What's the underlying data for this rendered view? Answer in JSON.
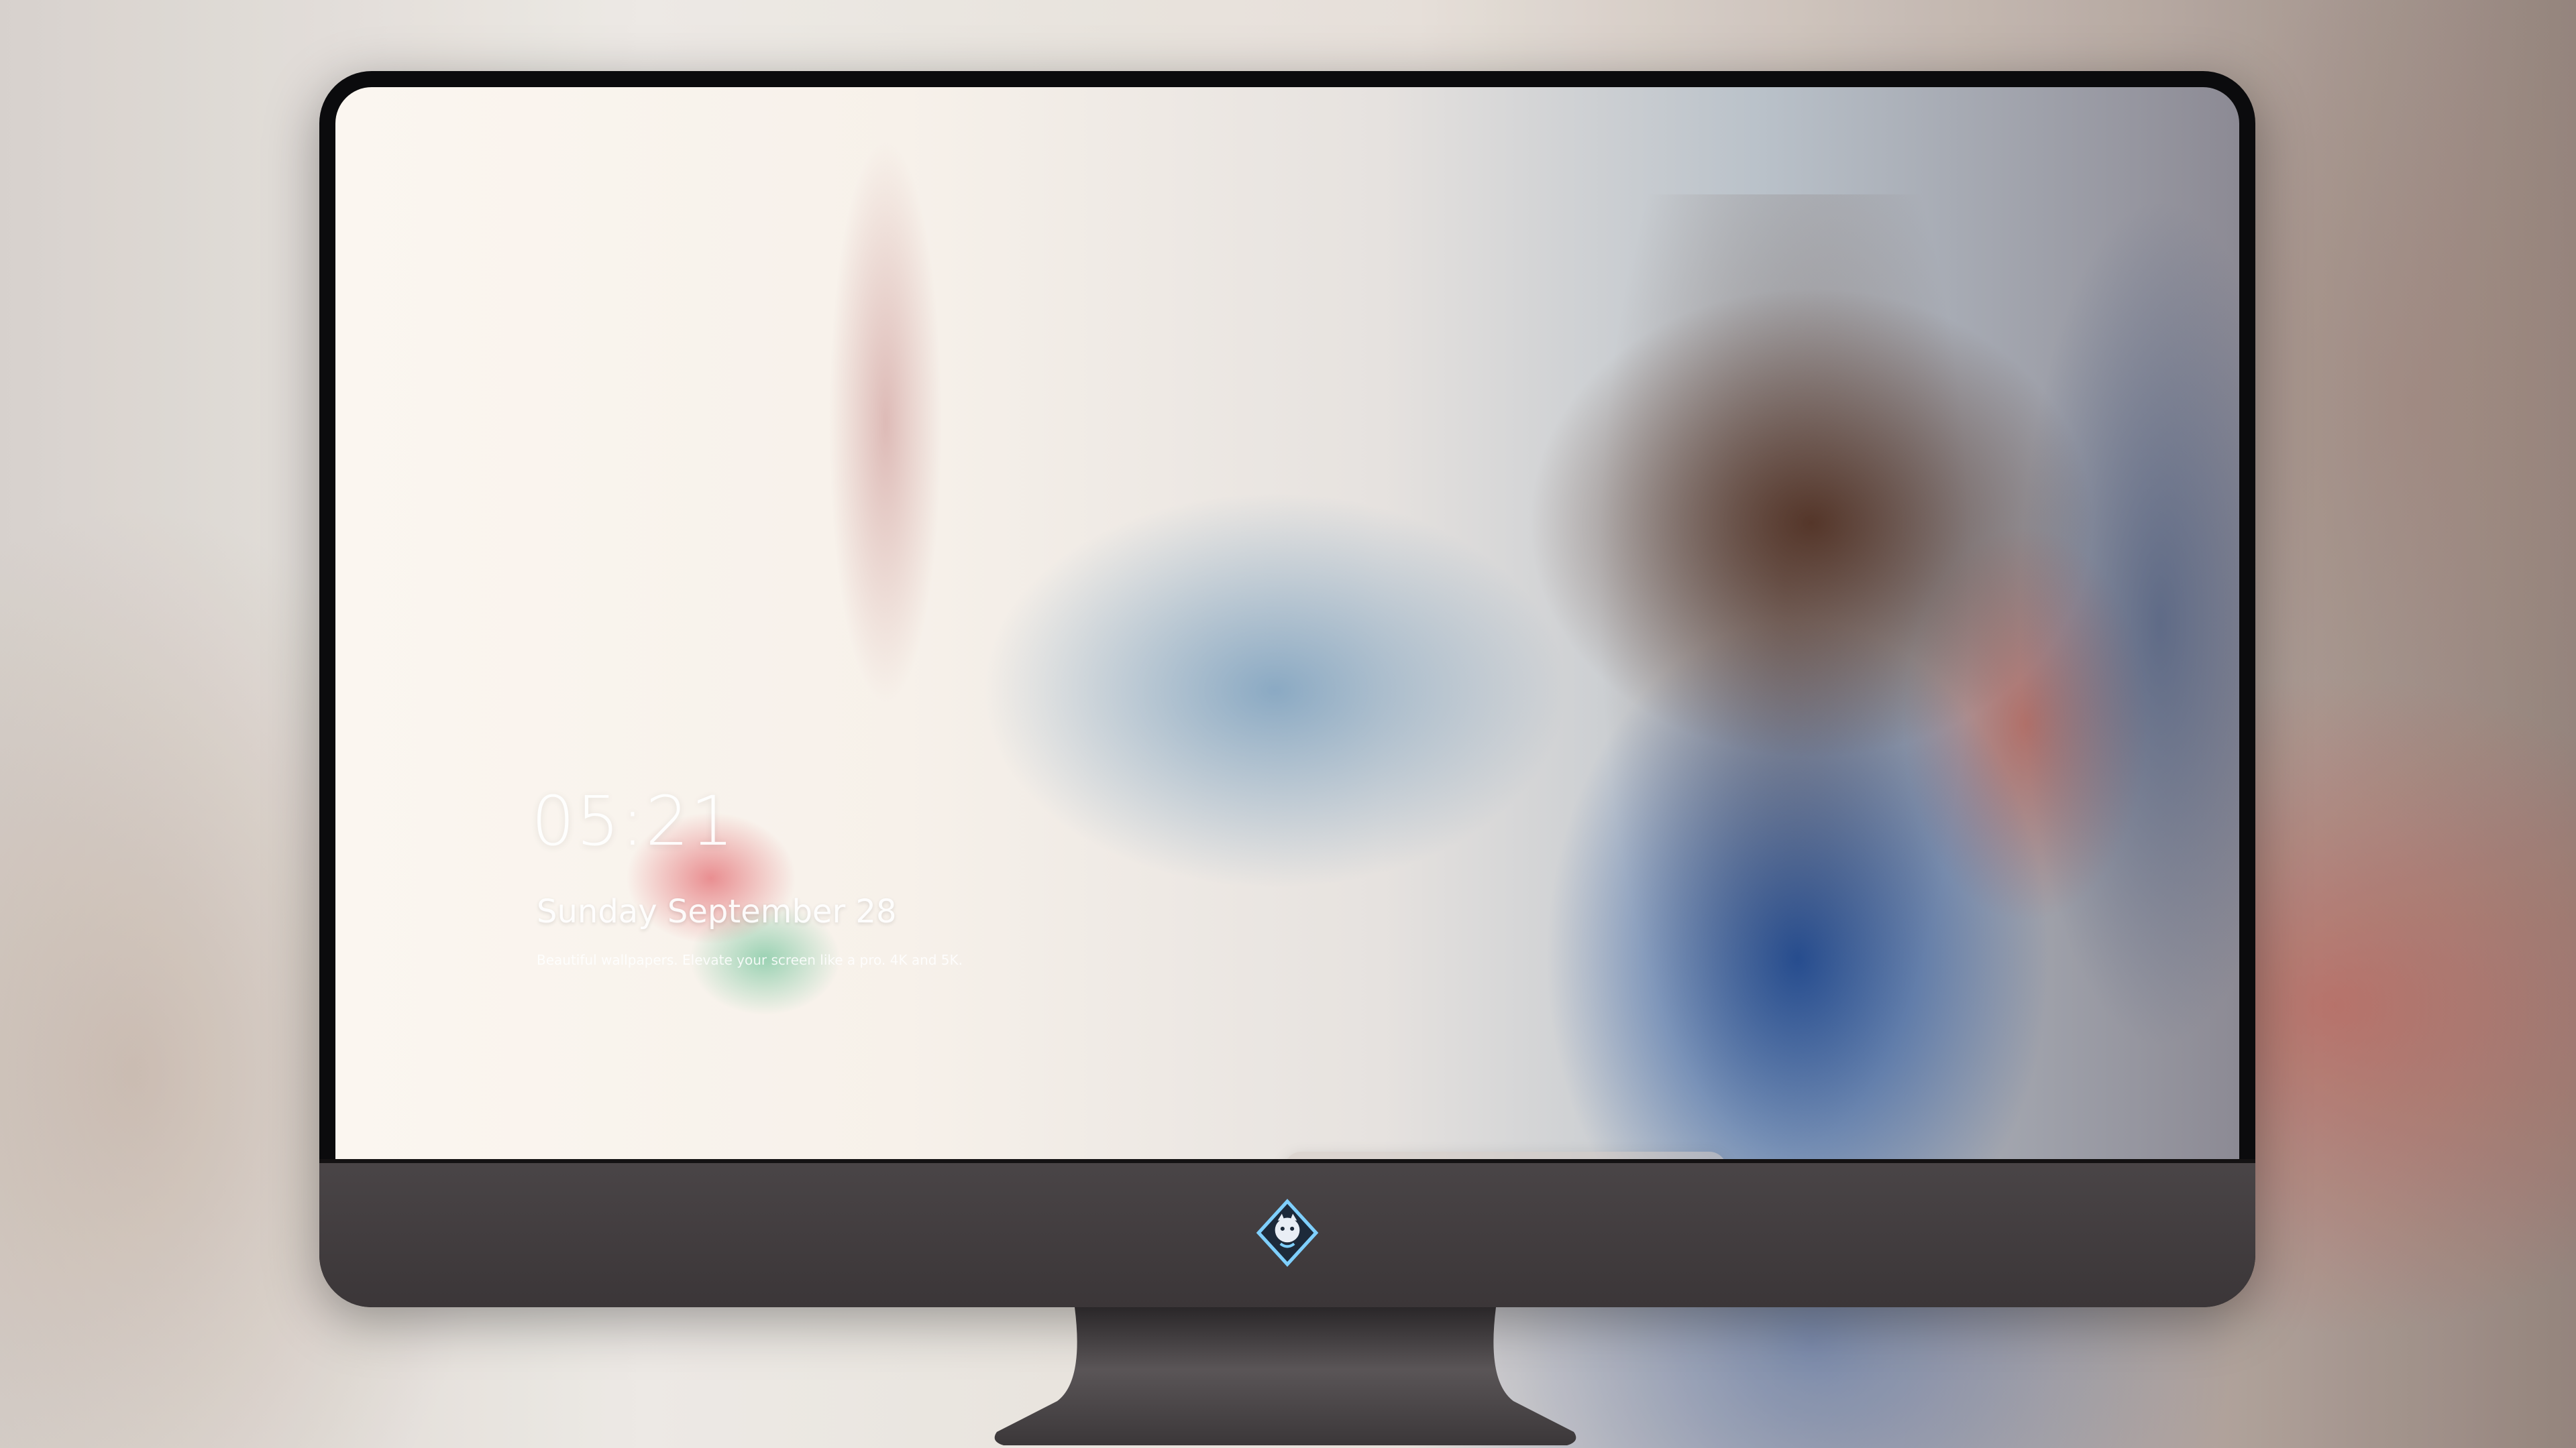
{
  "lockscreen": {
    "time": "05:21",
    "date": "Sunday  September  28",
    "tagline": "Beautiful wallpapers. Elevate your screen like a pro. 4K and 5K."
  },
  "dock": {
    "items": [
      {
        "name": "messages-icon",
        "color": "#34c759"
      },
      {
        "name": "weather-icon",
        "color": "#2f8ff0"
      },
      {
        "name": "clock-icon",
        "color": "#111111"
      },
      {
        "name": "preview-icon",
        "color": "#d8b24a"
      },
      {
        "name": "video-editor-icon",
        "color": "#55c4e8"
      },
      {
        "name": "notes-icon",
        "color": "#f7d04d"
      },
      {
        "name": "mosaic-app-icon",
        "color": "#e84e3c"
      },
      {
        "name": "music-icon",
        "color": "#d94cd8"
      },
      {
        "name": "app-store-icon",
        "color": "#1e8cf0"
      },
      {
        "name": "camera-icon",
        "color": "#555555"
      }
    ]
  },
  "colors": {
    "bezel": "#3f3a3c",
    "frame": "#0b0b0d",
    "dock": "#d2c8c3"
  }
}
